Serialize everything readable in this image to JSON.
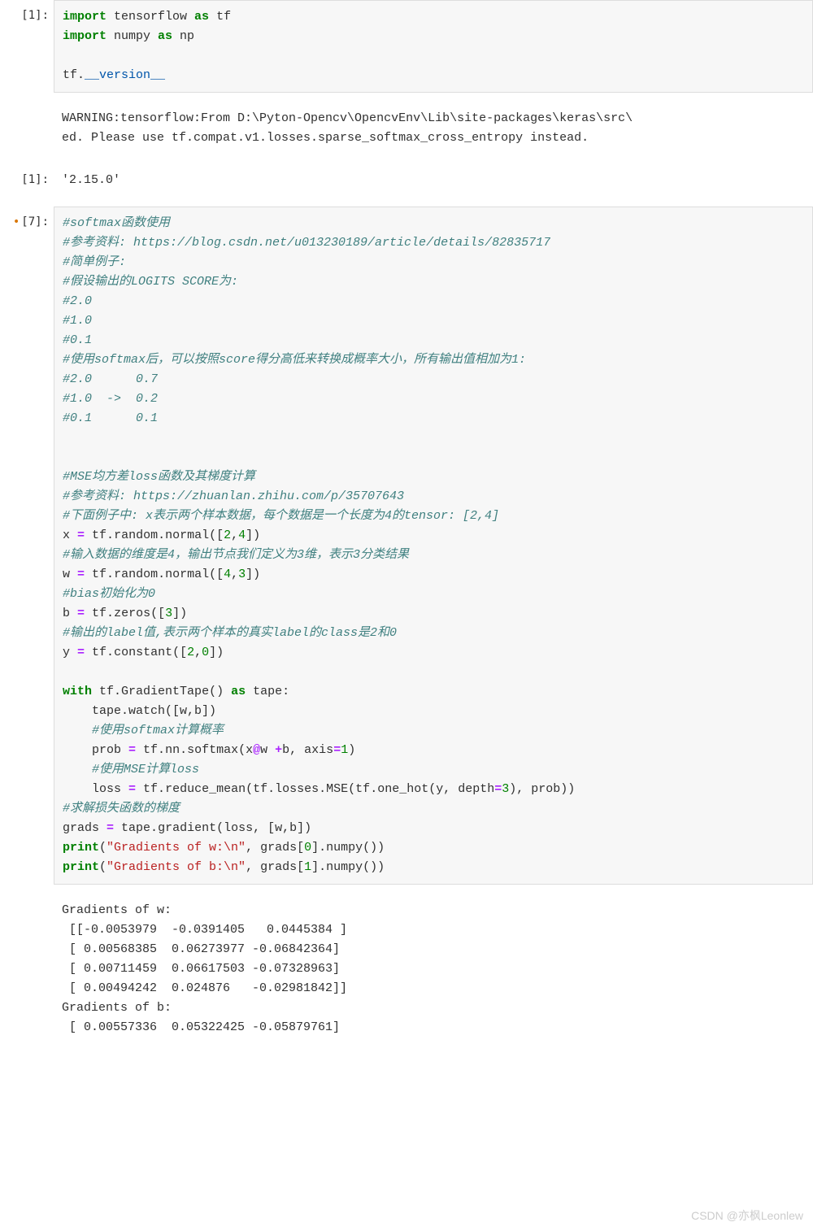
{
  "cells": [
    {
      "prompt": "[1]:",
      "type": "code",
      "lines": [
        {
          "kind": "code",
          "tokens": [
            {
              "t": "import",
              "c": "kw"
            },
            {
              "t": " tensorflow ",
              "c": "nm"
            },
            {
              "t": "as",
              "c": "kw"
            },
            {
              "t": " tf",
              "c": "nm"
            }
          ]
        },
        {
          "kind": "code",
          "tokens": [
            {
              "t": "import",
              "c": "kw"
            },
            {
              "t": " numpy ",
              "c": "nm"
            },
            {
              "t": "as",
              "c": "kw"
            },
            {
              "t": " np",
              "c": "nm"
            }
          ]
        },
        {
          "kind": "blank"
        },
        {
          "kind": "code",
          "tokens": [
            {
              "t": "tf",
              "c": "nm"
            },
            {
              "t": ".",
              "c": "nm"
            },
            {
              "t": "__version__",
              "c": "mag"
            }
          ]
        }
      ]
    },
    {
      "prompt": "",
      "type": "output",
      "text": "WARNING:tensorflow:From D:\\Pyton-Opencv\\OpencvEnv\\Lib\\site-packages\\keras\\src\\\ned. Please use tf.compat.v1.losses.sparse_softmax_cross_entropy instead."
    },
    {
      "prompt": "[1]:",
      "type": "output",
      "text": "'2.15.0'"
    },
    {
      "prompt": "[7]:",
      "dirty": true,
      "type": "code",
      "lines": [
        {
          "kind": "cmt",
          "text": "#softmax函数使用"
        },
        {
          "kind": "cmt",
          "text": "#参考资料: https://blog.csdn.net/u013230189/article/details/82835717"
        },
        {
          "kind": "cmt",
          "text": "#简单例子:"
        },
        {
          "kind": "cmt",
          "text": "#假设输出的LOGITS SCORE为:"
        },
        {
          "kind": "cmt",
          "text": "#2.0"
        },
        {
          "kind": "cmt",
          "text": "#1.0"
        },
        {
          "kind": "cmt",
          "text": "#0.1"
        },
        {
          "kind": "cmt",
          "text": "#使用softmax后，可以按照score得分高低来转换成概率大小，所有输出值相加为1:"
        },
        {
          "kind": "cmt",
          "text": "#2.0      0.7"
        },
        {
          "kind": "cmt",
          "text": "#1.0  ->  0.2"
        },
        {
          "kind": "cmt",
          "text": "#0.1      0.1"
        },
        {
          "kind": "blank"
        },
        {
          "kind": "blank"
        },
        {
          "kind": "cmt",
          "text": "#MSE均方差loss函数及其梯度计算"
        },
        {
          "kind": "cmt",
          "text": "#参考资料: https://zhuanlan.zhihu.com/p/35707643"
        },
        {
          "kind": "cmt",
          "text": "#下面例子中: x表示两个样本数据，每个数据是一个长度为4的tensor: [2,4]"
        },
        {
          "kind": "code",
          "tokens": [
            {
              "t": "x ",
              "c": "nm"
            },
            {
              "t": "=",
              "c": "op"
            },
            {
              "t": " tf",
              "c": "nm"
            },
            {
              "t": ".",
              "c": "nm"
            },
            {
              "t": "random",
              "c": "nm"
            },
            {
              "t": ".",
              "c": "nm"
            },
            {
              "t": "normal",
              "c": "nm"
            },
            {
              "t": "([",
              "c": "nm"
            },
            {
              "t": "2",
              "c": "num"
            },
            {
              "t": ",",
              "c": "nm"
            },
            {
              "t": "4",
              "c": "num"
            },
            {
              "t": "])",
              "c": "nm"
            }
          ]
        },
        {
          "kind": "cmt",
          "text": "#输入数据的维度是4，输出节点我们定义为3维，表示3分类结果"
        },
        {
          "kind": "code",
          "tokens": [
            {
              "t": "w ",
              "c": "nm"
            },
            {
              "t": "=",
              "c": "op"
            },
            {
              "t": " tf",
              "c": "nm"
            },
            {
              "t": ".",
              "c": "nm"
            },
            {
              "t": "random",
              "c": "nm"
            },
            {
              "t": ".",
              "c": "nm"
            },
            {
              "t": "normal",
              "c": "nm"
            },
            {
              "t": "([",
              "c": "nm"
            },
            {
              "t": "4",
              "c": "num"
            },
            {
              "t": ",",
              "c": "nm"
            },
            {
              "t": "3",
              "c": "num"
            },
            {
              "t": "])",
              "c": "nm"
            }
          ]
        },
        {
          "kind": "cmt",
          "text": "#bias初始化为0"
        },
        {
          "kind": "code",
          "tokens": [
            {
              "t": "b ",
              "c": "nm"
            },
            {
              "t": "=",
              "c": "op"
            },
            {
              "t": " tf",
              "c": "nm"
            },
            {
              "t": ".",
              "c": "nm"
            },
            {
              "t": "zeros",
              "c": "nm"
            },
            {
              "t": "([",
              "c": "nm"
            },
            {
              "t": "3",
              "c": "num"
            },
            {
              "t": "])",
              "c": "nm"
            }
          ]
        },
        {
          "kind": "cmt",
          "text": "#输出的label值,表示两个样本的真实label的class是2和0"
        },
        {
          "kind": "code",
          "tokens": [
            {
              "t": "y ",
              "c": "nm"
            },
            {
              "t": "=",
              "c": "op"
            },
            {
              "t": " tf",
              "c": "nm"
            },
            {
              "t": ".",
              "c": "nm"
            },
            {
              "t": "constant",
              "c": "nm"
            },
            {
              "t": "([",
              "c": "nm"
            },
            {
              "t": "2",
              "c": "num"
            },
            {
              "t": ",",
              "c": "nm"
            },
            {
              "t": "0",
              "c": "num"
            },
            {
              "t": "])",
              "c": "nm"
            }
          ]
        },
        {
          "kind": "blank"
        },
        {
          "kind": "code",
          "tokens": [
            {
              "t": "with",
              "c": "kw"
            },
            {
              "t": " tf",
              "c": "nm"
            },
            {
              "t": ".",
              "c": "nm"
            },
            {
              "t": "GradientTape",
              "c": "nm"
            },
            {
              "t": "() ",
              "c": "nm"
            },
            {
              "t": "as",
              "c": "kw"
            },
            {
              "t": " tape:",
              "c": "nm"
            }
          ]
        },
        {
          "kind": "code",
          "tokens": [
            {
              "t": "    tape",
              "c": "nm"
            },
            {
              "t": ".",
              "c": "nm"
            },
            {
              "t": "watch",
              "c": "nm"
            },
            {
              "t": "([w,b])",
              "c": "nm"
            }
          ]
        },
        {
          "kind": "cmt",
          "text": "    #使用softmax计算概率"
        },
        {
          "kind": "code",
          "tokens": [
            {
              "t": "    prob ",
              "c": "nm"
            },
            {
              "t": "=",
              "c": "op"
            },
            {
              "t": " tf",
              "c": "nm"
            },
            {
              "t": ".",
              "c": "nm"
            },
            {
              "t": "nn",
              "c": "nm"
            },
            {
              "t": ".",
              "c": "nm"
            },
            {
              "t": "softmax",
              "c": "nm"
            },
            {
              "t": "(x",
              "c": "nm"
            },
            {
              "t": "@",
              "c": "op"
            },
            {
              "t": "w ",
              "c": "nm"
            },
            {
              "t": "+",
              "c": "op"
            },
            {
              "t": "b, axis",
              "c": "nm"
            },
            {
              "t": "=",
              "c": "op"
            },
            {
              "t": "1",
              "c": "num"
            },
            {
              "t": ")",
              "c": "nm"
            }
          ]
        },
        {
          "kind": "cmt",
          "text": "    #使用MSE计算loss"
        },
        {
          "kind": "code",
          "tokens": [
            {
              "t": "    loss ",
              "c": "nm"
            },
            {
              "t": "=",
              "c": "op"
            },
            {
              "t": " tf",
              "c": "nm"
            },
            {
              "t": ".",
              "c": "nm"
            },
            {
              "t": "reduce_mean",
              "c": "nm"
            },
            {
              "t": "(tf",
              "c": "nm"
            },
            {
              "t": ".",
              "c": "nm"
            },
            {
              "t": "losses",
              "c": "nm"
            },
            {
              "t": ".",
              "c": "nm"
            },
            {
              "t": "MSE",
              "c": "nm"
            },
            {
              "t": "(tf",
              "c": "nm"
            },
            {
              "t": ".",
              "c": "nm"
            },
            {
              "t": "one_hot",
              "c": "nm"
            },
            {
              "t": "(y, depth",
              "c": "nm"
            },
            {
              "t": "=",
              "c": "op"
            },
            {
              "t": "3",
              "c": "num"
            },
            {
              "t": "), prob))",
              "c": "nm"
            }
          ]
        },
        {
          "kind": "cmt",
          "text": "#求解损失函数的梯度"
        },
        {
          "kind": "code",
          "tokens": [
            {
              "t": "grads ",
              "c": "nm"
            },
            {
              "t": "=",
              "c": "op"
            },
            {
              "t": " tape",
              "c": "nm"
            },
            {
              "t": ".",
              "c": "nm"
            },
            {
              "t": "gradient",
              "c": "nm"
            },
            {
              "t": "(loss, [w,b])",
              "c": "nm"
            }
          ]
        },
        {
          "kind": "code",
          "tokens": [
            {
              "t": "print",
              "c": "kw"
            },
            {
              "t": "(",
              "c": "nm"
            },
            {
              "t": "\"Gradients of w:\\n\"",
              "c": "str"
            },
            {
              "t": ", grads[",
              "c": "nm"
            },
            {
              "t": "0",
              "c": "num"
            },
            {
              "t": "]",
              "c": "nm"
            },
            {
              "t": ".",
              "c": "nm"
            },
            {
              "t": "numpy",
              "c": "nm"
            },
            {
              "t": "())",
              "c": "nm"
            }
          ]
        },
        {
          "kind": "code",
          "tokens": [
            {
              "t": "print",
              "c": "kw"
            },
            {
              "t": "(",
              "c": "nm"
            },
            {
              "t": "\"Gradients of b:\\n\"",
              "c": "str"
            },
            {
              "t": ", grads[",
              "c": "nm"
            },
            {
              "t": "1",
              "c": "num"
            },
            {
              "t": "]",
              "c": "nm"
            },
            {
              "t": ".",
              "c": "nm"
            },
            {
              "t": "numpy",
              "c": "nm"
            },
            {
              "t": "())",
              "c": "nm"
            }
          ]
        }
      ]
    },
    {
      "prompt": "",
      "type": "output",
      "text": "Gradients of w:\n [[-0.0053979  -0.0391405   0.0445384 ]\n [ 0.00568385  0.06273977 -0.06842364]\n [ 0.00711459  0.06617503 -0.07328963]\n [ 0.00494242  0.024876   -0.02981842]]\nGradients of b:\n [ 0.00557336  0.05322425 -0.05879761]"
    }
  ],
  "watermark": "CSDN @亦枫Leonlew"
}
